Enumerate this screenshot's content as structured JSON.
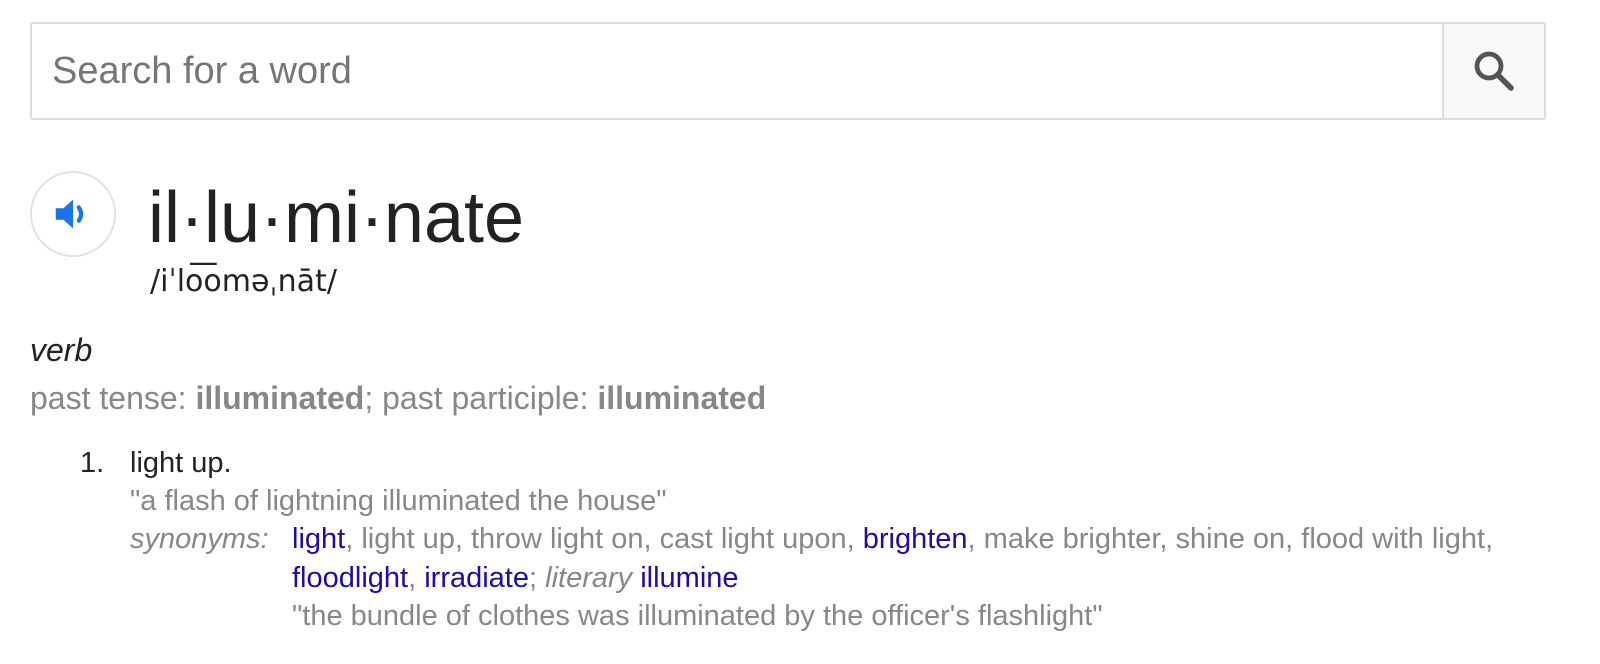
{
  "search": {
    "placeholder": "Search for a word",
    "value": "",
    "icon": "search-icon"
  },
  "speaker": {
    "icon": "speaker-icon",
    "color": "#1a73e8"
  },
  "entry": {
    "headword": "il·lu·mi·nate",
    "pronunciation": "/iˈlo͞oməˌnāt/",
    "part_of_speech": "verb",
    "inflections": {
      "label_1": "past tense: ",
      "value_1": "illuminated",
      "separator": "; ",
      "label_2": "past participle: ",
      "value_2": "illuminated"
    },
    "senses": [
      {
        "number": "1.",
        "definition": "light up.",
        "example": "\"a flash of lightning illuminated the house\"",
        "synonyms_label": "synonyms:",
        "synonyms": [
          {
            "text": "light",
            "link": true,
            "sep": ", "
          },
          {
            "text": "light up",
            "link": false,
            "sep": ", "
          },
          {
            "text": "throw light on",
            "link": false,
            "sep": ", "
          },
          {
            "text": "cast light upon",
            "link": false,
            "sep": ", "
          },
          {
            "text": "brighten",
            "link": true,
            "sep": ", "
          },
          {
            "text": "make brighter",
            "link": false,
            "sep": ", "
          },
          {
            "text": "shine on",
            "link": false,
            "sep": ", "
          },
          {
            "text": "flood with light",
            "link": false,
            "sep": ", "
          },
          {
            "text": "floodlight",
            "link": true,
            "sep": ", "
          },
          {
            "text": "irradiate",
            "link": true,
            "sep": "; "
          }
        ],
        "register_label": "literary",
        "literary_synonym": "illumine",
        "synonym_example": "\"the bundle of clothes was illuminated by the officer's flashlight\""
      }
    ]
  },
  "colors": {
    "link": "#1a0dab",
    "muted_text": "#878787",
    "main_text": "#222222",
    "border": "#dcdcdc"
  }
}
